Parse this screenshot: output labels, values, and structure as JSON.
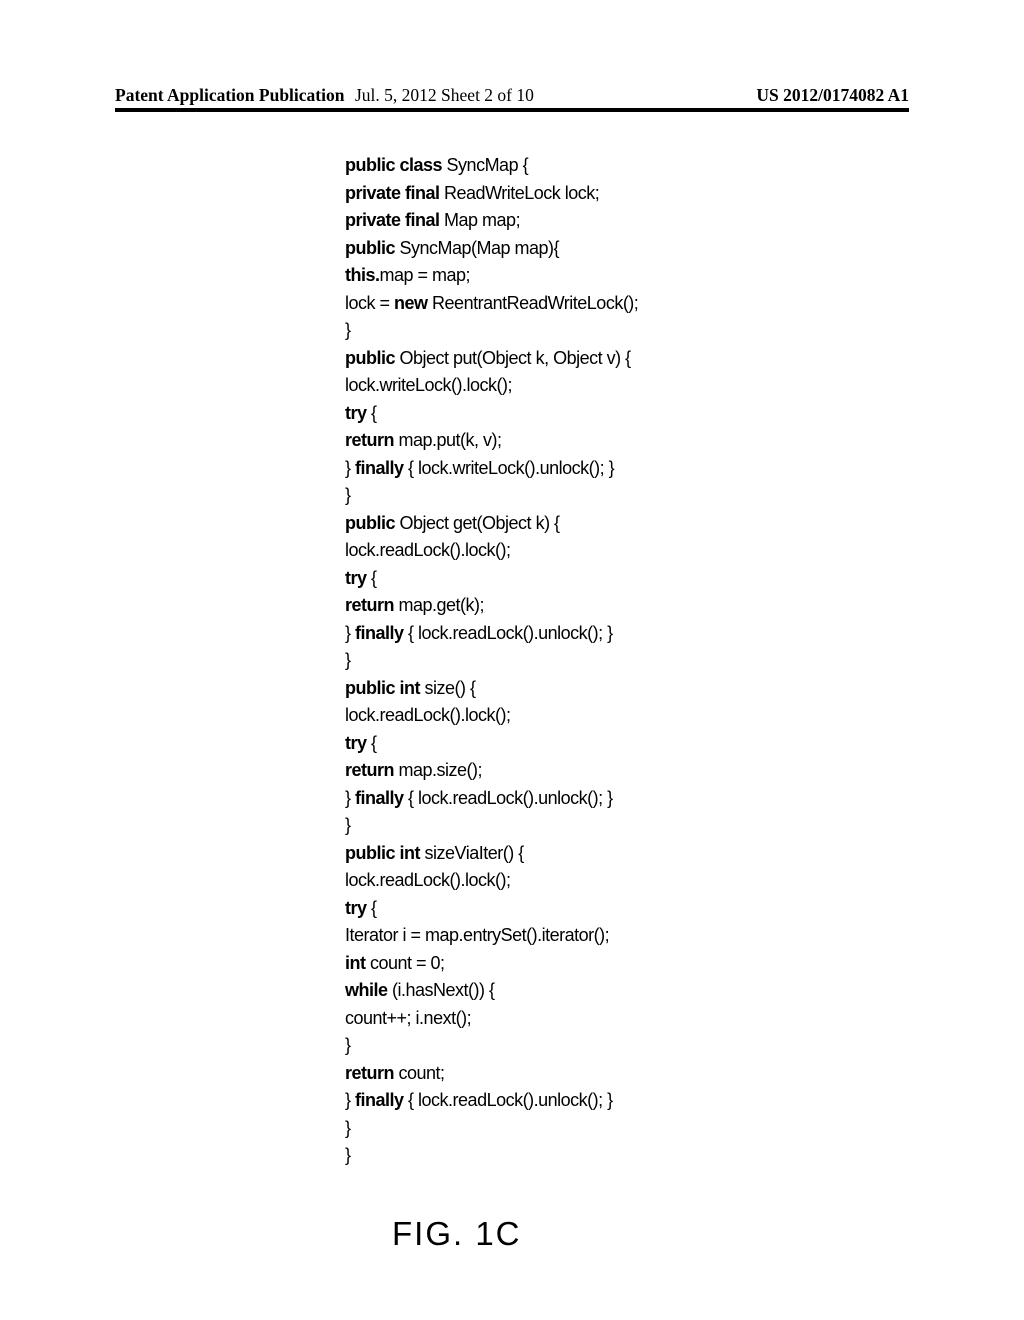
{
  "header": {
    "left": "Patent Application Publication",
    "mid": "Jul. 5, 2012   Sheet 2 of 10",
    "right": "US 2012/0174082 A1"
  },
  "code": {
    "lines": [
      [
        {
          "t": "public class ",
          "b": true
        },
        {
          "t": "SyncMap {",
          "b": false
        }
      ],
      [
        {
          "t": "private final ",
          "b": true
        },
        {
          "t": "ReadWriteLock lock;",
          "b": false
        }
      ],
      [
        {
          "t": "private final ",
          "b": true
        },
        {
          "t": "Map map;",
          "b": false
        }
      ],
      [
        {
          "t": "public ",
          "b": true
        },
        {
          "t": "SyncMap(Map map){",
          "b": false
        }
      ],
      [
        {
          "t": "this.",
          "b": true
        },
        {
          "t": "map = map;",
          "b": false
        }
      ],
      [
        {
          "t": "lock = ",
          "b": false
        },
        {
          "t": "new ",
          "b": true
        },
        {
          "t": "ReentrantReadWriteLock();",
          "b": false
        }
      ],
      [
        {
          "t": "}",
          "b": false
        }
      ],
      [
        {
          "t": "public ",
          "b": true
        },
        {
          "t": "Object put(Object k, Object v) {",
          "b": false
        }
      ],
      [
        {
          "t": "lock.writeLock().lock();",
          "b": false
        }
      ],
      [
        {
          "t": "try ",
          "b": true
        },
        {
          "t": "{",
          "b": false
        }
      ],
      [
        {
          "t": "return ",
          "b": true
        },
        {
          "t": "map.put(k, v);",
          "b": false
        }
      ],
      [
        {
          "t": "} ",
          "b": false
        },
        {
          "t": "finally ",
          "b": true
        },
        {
          "t": "{ lock.writeLock().unlock(); }",
          "b": false
        }
      ],
      [
        {
          "t": "}",
          "b": false
        }
      ],
      [
        {
          "t": "public ",
          "b": true
        },
        {
          "t": "Object get(Object k) {",
          "b": false
        }
      ],
      [
        {
          "t": "lock.readLock().lock();",
          "b": false
        }
      ],
      [
        {
          "t": "try ",
          "b": true
        },
        {
          "t": "{",
          "b": false
        }
      ],
      [
        {
          "t": "return ",
          "b": true
        },
        {
          "t": "map.get(k);",
          "b": false
        }
      ],
      [
        {
          "t": "} ",
          "b": false
        },
        {
          "t": "finally ",
          "b": true
        },
        {
          "t": "{ lock.readLock().unlock(); }",
          "b": false
        }
      ],
      [
        {
          "t": "}",
          "b": false
        }
      ],
      [
        {
          "t": "public int ",
          "b": true
        },
        {
          "t": "size() {",
          "b": false
        }
      ],
      [
        {
          "t": "lock.readLock().lock();",
          "b": false
        }
      ],
      [
        {
          "t": "try ",
          "b": true
        },
        {
          "t": "{",
          "b": false
        }
      ],
      [
        {
          "t": "return ",
          "b": true
        },
        {
          "t": "map.size();",
          "b": false
        }
      ],
      [
        {
          "t": "} ",
          "b": false
        },
        {
          "t": "finally ",
          "b": true
        },
        {
          "t": "{ lock.readLock().unlock(); }",
          "b": false
        }
      ],
      [
        {
          "t": "}",
          "b": false
        }
      ],
      [
        {
          "t": "public int ",
          "b": true
        },
        {
          "t": "sizeViaIter() {",
          "b": false
        }
      ],
      [
        {
          "t": "lock.readLock().lock();",
          "b": false
        }
      ],
      [
        {
          "t": "try ",
          "b": true
        },
        {
          "t": "{",
          "b": false
        }
      ],
      [
        {
          "t": "Iterator i = map.entrySet().iterator();",
          "b": false
        }
      ],
      [
        {
          "t": "int ",
          "b": true
        },
        {
          "t": "count = 0;",
          "b": false
        }
      ],
      [
        {
          "t": "while ",
          "b": true
        },
        {
          "t": "(i.hasNext()) {",
          "b": false
        }
      ],
      [
        {
          "t": "count++; i.next();",
          "b": false
        }
      ],
      [
        {
          "t": "}",
          "b": false
        }
      ],
      [
        {
          "t": "return ",
          "b": true
        },
        {
          "t": "count;",
          "b": false
        }
      ],
      [
        {
          "t": "} ",
          "b": false
        },
        {
          "t": "finally ",
          "b": true
        },
        {
          "t": "{ lock.readLock().unlock(); }",
          "b": false
        }
      ],
      [
        {
          "t": "}",
          "b": false
        }
      ],
      [
        {
          "t": "}",
          "b": false
        }
      ]
    ]
  },
  "figure_caption": "FIG. 1C"
}
